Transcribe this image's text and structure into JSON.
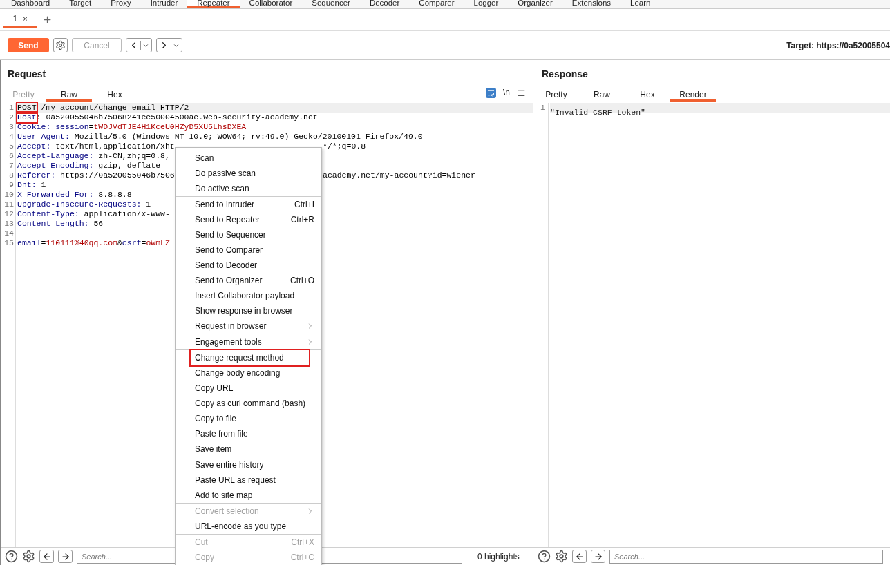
{
  "main_tabs": [
    {
      "label": "Dashboard",
      "selected": false
    },
    {
      "label": "Target",
      "selected": false
    },
    {
      "label": "Proxy",
      "selected": false
    },
    {
      "label": "Intruder",
      "selected": false
    },
    {
      "label": "Repeater",
      "selected": true
    },
    {
      "label": "Collaborator",
      "selected": false
    },
    {
      "label": "Sequencer",
      "selected": false
    },
    {
      "label": "Decoder",
      "selected": false
    },
    {
      "label": "Comparer",
      "selected": false
    },
    {
      "label": "Logger",
      "selected": false
    },
    {
      "label": "Organizer",
      "selected": false
    },
    {
      "label": "Extensions",
      "selected": false
    },
    {
      "label": "Learn",
      "selected": false
    }
  ],
  "repeater_tabs": [
    {
      "label": "1",
      "close": "×",
      "selected": true
    }
  ],
  "toolbar": {
    "send": "Send",
    "cancel": "Cancel",
    "target": "Target: https://0a52005504"
  },
  "request": {
    "title": "Request",
    "tabs": [
      {
        "label": "Pretty",
        "selected": false,
        "disabled": true
      },
      {
        "label": "Raw",
        "selected": true,
        "disabled": false
      },
      {
        "label": "Hex",
        "selected": false,
        "disabled": false
      }
    ],
    "newline_toggle": "\\n",
    "lines": [
      {
        "num": "1",
        "current": true,
        "left": [
          {
            "text": "POST",
            "kind": "plain",
            "boxed": true
          },
          {
            "text": " /my-account/change-email HTTP/2",
            "kind": "plain",
            "boxed": false
          }
        ]
      },
      {
        "num": "2",
        "current": false,
        "left": [
          {
            "text": "Host",
            "kind": "name",
            "boxed": true
          },
          {
            "text": ": 0a520055046b75068241ee50004500ae.web-security-academy.net",
            "kind": "plain",
            "boxed": false
          }
        ]
      },
      {
        "num": "3",
        "current": false,
        "left": [
          {
            "text": "Cookie: ",
            "kind": "name",
            "boxed": false
          },
          {
            "text": "session",
            "kind": "name",
            "boxed": false
          },
          {
            "text": "=",
            "kind": "plain",
            "boxed": false
          },
          {
            "text": "tWDJVdTJE4H1KceU0HZyD5XU5LhsDXEA",
            "kind": "value",
            "boxed": false
          }
        ]
      },
      {
        "num": "4",
        "current": false,
        "left": [
          {
            "text": "User-Agent:",
            "kind": "name",
            "boxed": false
          },
          {
            "text": " Mozilla/5.0 (Windows NT 10.0; WOW64; rv:49.0) Gecko/20100101 Firefox/49.0",
            "kind": "plain",
            "boxed": false
          }
        ]
      },
      {
        "num": "5",
        "current": false,
        "left": [
          {
            "text": "Accept:",
            "kind": "name",
            "boxed": false
          },
          {
            "text": " text/html,application/xht",
            "kind": "plain",
            "boxed": false
          }
        ],
        "right": [
          {
            "text": "*/*;q=0.8"
          }
        ]
      },
      {
        "num": "6",
        "current": false,
        "left": [
          {
            "text": "Accept-Language:",
            "kind": "name",
            "boxed": false
          },
          {
            "text": " zh-CN,zh;q=0.8,",
            "kind": "plain",
            "boxed": false
          }
        ]
      },
      {
        "num": "7",
        "current": false,
        "left": [
          {
            "text": "Accept-Encoding:",
            "kind": "name",
            "boxed": false
          },
          {
            "text": " gzip, deflate",
            "kind": "plain",
            "boxed": false
          }
        ]
      },
      {
        "num": "8",
        "current": false,
        "left": [
          {
            "text": "Referer:",
            "kind": "name",
            "boxed": false
          },
          {
            "text": " https://0a520055046b7506",
            "kind": "plain",
            "boxed": false
          }
        ],
        "right": [
          {
            "text": "academy.net/my-account?id=wiener"
          }
        ]
      },
      {
        "num": "9",
        "current": false,
        "left": [
          {
            "text": "Dnt:",
            "kind": "name",
            "boxed": false
          },
          {
            "text": " 1",
            "kind": "plain",
            "boxed": false
          }
        ]
      },
      {
        "num": "10",
        "current": false,
        "left": [
          {
            "text": "X-Forwarded-For:",
            "kind": "name",
            "boxed": false
          },
          {
            "text": " 8.8.8.8",
            "kind": "plain",
            "boxed": false
          }
        ]
      },
      {
        "num": "11",
        "current": false,
        "left": [
          {
            "text": "Upgrade-Insecure-Requests:",
            "kind": "name",
            "boxed": false
          },
          {
            "text": " 1",
            "kind": "plain",
            "boxed": false
          }
        ]
      },
      {
        "num": "12",
        "current": false,
        "left": [
          {
            "text": "Content-Type:",
            "kind": "name",
            "boxed": false
          },
          {
            "text": " application/x-www-",
            "kind": "plain",
            "boxed": false
          }
        ]
      },
      {
        "num": "13",
        "current": false,
        "left": [
          {
            "text": "Content-Length:",
            "kind": "name",
            "boxed": false
          },
          {
            "text": " 56",
            "kind": "plain",
            "boxed": false
          }
        ]
      },
      {
        "num": "14",
        "current": false
      },
      {
        "num": "15",
        "current": false,
        "left": [
          {
            "text": "email",
            "kind": "name",
            "boxed": false
          },
          {
            "text": "=",
            "kind": "plain",
            "boxed": false
          },
          {
            "text": "110111%40qq.com",
            "kind": "value",
            "boxed": false
          },
          {
            "text": "&",
            "kind": "plain",
            "boxed": false
          },
          {
            "text": "csrf",
            "kind": "name",
            "boxed": false
          },
          {
            "text": "=",
            "kind": "plain",
            "boxed": false
          },
          {
            "text": "oWmLZ",
            "kind": "value",
            "boxed": false
          }
        ]
      }
    ],
    "search_placeholder": "Search...",
    "highlights": "0 highlights"
  },
  "response": {
    "title": "Response",
    "tabs": [
      {
        "label": "Pretty",
        "selected": false,
        "disabled": false
      },
      {
        "label": "Raw",
        "selected": false,
        "disabled": false
      },
      {
        "label": "Hex",
        "selected": false,
        "disabled": false
      },
      {
        "label": "Render",
        "selected": true,
        "disabled": false
      }
    ],
    "lines": [
      {
        "num": "1",
        "current": true,
        "text": "\"Invalid CSRF token\""
      }
    ],
    "search_placeholder": "Search..."
  },
  "context_menu": [
    {
      "kind": "item",
      "label": "Scan",
      "disabled": false,
      "submenu": false,
      "boxed": false
    },
    {
      "kind": "item",
      "label": "Do passive scan",
      "disabled": false,
      "submenu": false,
      "boxed": false
    },
    {
      "kind": "item",
      "label": "Do active scan",
      "disabled": false,
      "submenu": false,
      "boxed": false
    },
    {
      "kind": "separator"
    },
    {
      "kind": "item",
      "label": "Send to Intruder",
      "shortcut": "Ctrl+I",
      "disabled": false,
      "submenu": false,
      "boxed": false
    },
    {
      "kind": "item",
      "label": "Send to Repeater",
      "shortcut": "Ctrl+R",
      "disabled": false,
      "submenu": false,
      "boxed": false
    },
    {
      "kind": "item",
      "label": "Send to Sequencer",
      "disabled": false,
      "submenu": false,
      "boxed": false
    },
    {
      "kind": "item",
      "label": "Send to Comparer",
      "disabled": false,
      "submenu": false,
      "boxed": false
    },
    {
      "kind": "item",
      "label": "Send to Decoder",
      "disabled": false,
      "submenu": false,
      "boxed": false
    },
    {
      "kind": "item",
      "label": "Send to Organizer",
      "shortcut": "Ctrl+O",
      "disabled": false,
      "submenu": false,
      "boxed": false
    },
    {
      "kind": "item",
      "label": "Insert Collaborator payload",
      "disabled": false,
      "submenu": false,
      "boxed": false
    },
    {
      "kind": "item",
      "label": "Show response in browser",
      "disabled": false,
      "submenu": false,
      "boxed": false
    },
    {
      "kind": "item",
      "label": "Request in browser",
      "disabled": false,
      "submenu": true,
      "boxed": false
    },
    {
      "kind": "separator"
    },
    {
      "kind": "item",
      "label": "Engagement tools",
      "disabled": false,
      "submenu": true,
      "boxed": false
    },
    {
      "kind": "separator"
    },
    {
      "kind": "item",
      "label": "Change request method",
      "disabled": false,
      "submenu": false,
      "boxed": true
    },
    {
      "kind": "item",
      "label": "Change body encoding",
      "disabled": false,
      "submenu": false,
      "boxed": false
    },
    {
      "kind": "item",
      "label": "Copy URL",
      "disabled": false,
      "submenu": false,
      "boxed": false
    },
    {
      "kind": "item",
      "label": "Copy as curl command (bash)",
      "disabled": false,
      "submenu": false,
      "boxed": false
    },
    {
      "kind": "item",
      "label": "Copy to file",
      "disabled": false,
      "submenu": false,
      "boxed": false
    },
    {
      "kind": "item",
      "label": "Paste from file",
      "disabled": false,
      "submenu": false,
      "boxed": false
    },
    {
      "kind": "item",
      "label": "Save item",
      "disabled": false,
      "submenu": false,
      "boxed": false
    },
    {
      "kind": "separator"
    },
    {
      "kind": "item",
      "label": "Save entire history",
      "disabled": false,
      "submenu": false,
      "boxed": false
    },
    {
      "kind": "item",
      "label": "Paste URL as request",
      "disabled": false,
      "submenu": false,
      "boxed": false
    },
    {
      "kind": "item",
      "label": "Add to site map",
      "disabled": false,
      "submenu": false,
      "boxed": false
    },
    {
      "kind": "separator"
    },
    {
      "kind": "item",
      "label": "Convert selection",
      "disabled": true,
      "submenu": true,
      "boxed": false
    },
    {
      "kind": "item",
      "label": "URL-encode as you type",
      "disabled": false,
      "submenu": false,
      "boxed": false
    },
    {
      "kind": "separator"
    },
    {
      "kind": "item",
      "label": "Cut",
      "shortcut": "Ctrl+X",
      "disabled": true,
      "submenu": false,
      "boxed": false
    },
    {
      "kind": "item",
      "label": "Copy",
      "shortcut": "Ctrl+C",
      "disabled": true,
      "submenu": false,
      "boxed": false
    }
  ]
}
